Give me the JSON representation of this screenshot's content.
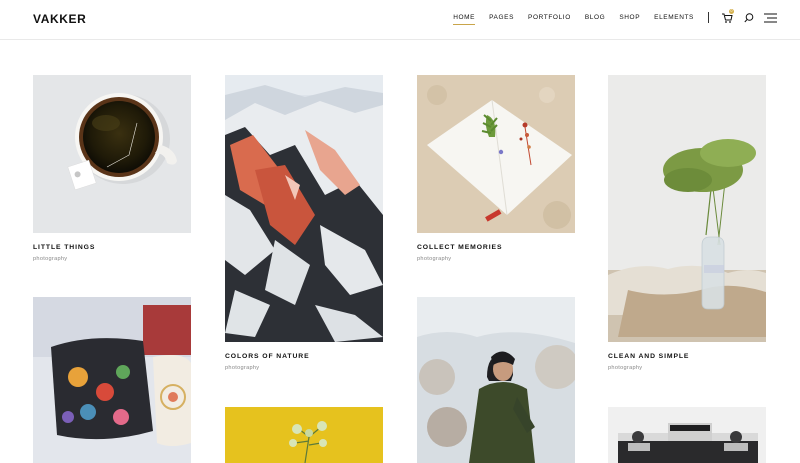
{
  "brand": {
    "name": "VAKKER"
  },
  "nav": {
    "items": [
      "HOME",
      "PAGES",
      "PORTFOLIO",
      "BLOG",
      "SHOP",
      "ELEMENTS"
    ],
    "active_index": 0
  },
  "cart": {
    "count": "0"
  },
  "colors": {
    "accent": "#c9a54a"
  },
  "portfolio": [
    {
      "title": "LITTLE THINGS",
      "category": "photography"
    },
    {
      "title": "COLORS OF NATURE",
      "category": "photography"
    },
    {
      "title": "COLLECT MEMORIES",
      "category": "photography"
    },
    {
      "title": "CLEAN AND SIMPLE",
      "category": "photography"
    }
  ]
}
